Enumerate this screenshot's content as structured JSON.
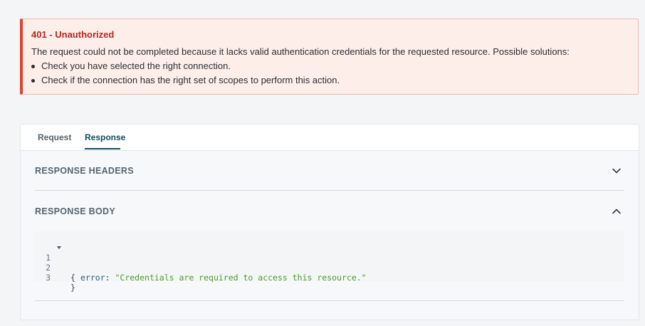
{
  "alert": {
    "title": "401 - Unauthorized",
    "message": "The request could not be completed because it lacks valid authentication credentials for the requested resource. Possible solutions:",
    "solutions": [
      "Check you have selected the right connection.",
      "Check if the connection has the right set of scopes to perform this action."
    ],
    "colors": {
      "accent": "#d9432c",
      "background": "#fdeeea",
      "title": "#b3261e"
    }
  },
  "tabs": {
    "request": "Request",
    "response": "Response",
    "active": "Response"
  },
  "sections": {
    "headers": {
      "title": "RESPONSE HEADERS",
      "icon": "chevron-down-icon"
    },
    "body": {
      "title": "RESPONSE BODY",
      "icon": "chevron-up-icon"
    }
  },
  "code": {
    "lines": [
      {
        "number": "1",
        "open": "{"
      },
      {
        "number": "2",
        "key": "error",
        "colon": ": ",
        "value": "\"Credentials are required to access this resource.\""
      },
      {
        "number": "3",
        "close": "}"
      }
    ]
  }
}
